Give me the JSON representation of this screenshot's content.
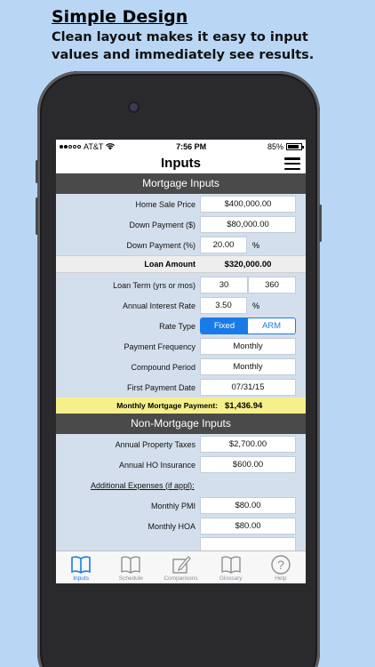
{
  "promo": {
    "title": "Simple Design",
    "subtitle": "Clean layout makes it easy to input values and immediately see results."
  },
  "status_bar": {
    "carrier": "AT&T",
    "time": "7:56 PM",
    "battery": "85%"
  },
  "nav": {
    "title": "Inputs",
    "menu_icon": "hamburger-menu-icon"
  },
  "mortgage": {
    "header": "Mortgage Inputs",
    "home_sale_price": {
      "label": "Home Sale Price",
      "value": "$400,000.00"
    },
    "down_payment": {
      "label": "Down Payment ($)",
      "value": "$80,000.00"
    },
    "down_payment_pct": {
      "label": "Down Payment (%)",
      "value": "20.00",
      "unit": "%"
    },
    "loan_amount": {
      "label": "Loan Amount",
      "value": "$320,000.00"
    },
    "loan_term": {
      "label": "Loan Term (yrs or mos)",
      "years": "30",
      "months": "360"
    },
    "interest_rate": {
      "label": "Annual Interest Rate",
      "value": "3.50",
      "unit": "%"
    },
    "rate_type": {
      "label": "Rate Type",
      "options": [
        "Fixed",
        "ARM"
      ],
      "selected": "Fixed"
    },
    "payment_frequency": {
      "label": "Payment Frequency",
      "value": "Monthly"
    },
    "compound_period": {
      "label": "Compound Period",
      "value": "Monthly"
    },
    "first_payment_date": {
      "label": "First Payment Date",
      "value": "07/31/15"
    },
    "monthly_payment": {
      "label": "Monthly Mortgage Payment:",
      "value": "$1,436.94"
    }
  },
  "non_mortgage": {
    "header": "Non-Mortgage Inputs",
    "property_taxes": {
      "label": "Annual Property Taxes",
      "value": "$2,700.00"
    },
    "ho_insurance": {
      "label": "Annual HO Insurance",
      "value": "$600.00"
    },
    "additional_expenses_label": "Additional Expenses (if appl):",
    "pmi": {
      "label": "Monthly PMI",
      "value": "$80.00"
    },
    "hoa": {
      "label": "Monthly HOA",
      "value": "$80.00"
    }
  },
  "tabs": [
    {
      "label": "Inputs",
      "icon": "book-icon",
      "active": true
    },
    {
      "label": "Schedule",
      "icon": "book-icon",
      "active": false
    },
    {
      "label": "Comparisons",
      "icon": "edit-icon",
      "active": false
    },
    {
      "label": "Glossary",
      "icon": "book-icon",
      "active": false
    },
    {
      "label": "Help",
      "icon": "help-icon",
      "active": false
    }
  ],
  "colors": {
    "accent": "#1a7be7",
    "section_header": "#4a4a4a",
    "content_bg": "#d3dfec",
    "highlight": "#f6f08c",
    "page_bg": "#b9d7f5"
  }
}
